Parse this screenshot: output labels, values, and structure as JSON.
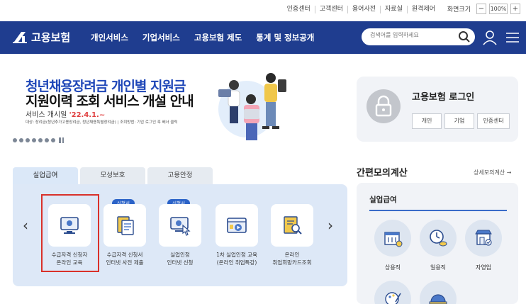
{
  "util": {
    "links": [
      "인증센터",
      "고객센터",
      "용어사전",
      "자료실",
      "원격제어"
    ],
    "zoom_label": "화면크기",
    "zoom_minus": "−",
    "zoom_value": "100%",
    "zoom_plus": "+"
  },
  "header": {
    "logo_text": "고용보험",
    "nav": [
      "개인서비스",
      "기업서비스",
      "고용보험 제도",
      "통계 및 정보공개"
    ],
    "search_placeholder": "검색어를 입력하세요",
    "icons": [
      "search-icon",
      "user-icon",
      "menu-icon"
    ],
    "brand_color": "#1f3d8f"
  },
  "banner": {
    "line1": "청년채용장려금 개인별 지원금",
    "line2": "지원이력 조회 서비스 개설 안내",
    "open_label": "서비스 개시일 ",
    "open_date": "'22.4.1.~",
    "note": "대상: 장려금(청년추가고용장려금, 청년채용특별장려금) | 조회방법: 기업 로그인 후 배너 클릭",
    "slide_count": 7
  },
  "login": {
    "title": "고용보험 로그인",
    "buttons": [
      "개인",
      "기업",
      "인증센터"
    ]
  },
  "tabs": [
    "실업급여",
    "모성보호",
    "고용안정"
  ],
  "services": [
    {
      "label": "수급자격 신청자\n온라인 교육",
      "badge": "",
      "icon": "monitor-icon"
    },
    {
      "label": "수급자격 신청서\n인터넷 사전 제출",
      "badge": "신청서",
      "icon": "document-icon"
    },
    {
      "label": "실업인정\n인터넷 신청",
      "badge": "신청서",
      "icon": "computer-click-icon"
    },
    {
      "label": "1차 실업인정 교육\n(온라인 취업특강)",
      "badge": "",
      "icon": "video-lecture-icon"
    },
    {
      "label": "온라인\n취업희망카드조회",
      "badge": "",
      "icon": "card-search-icon"
    }
  ],
  "calc": {
    "title": "간편모의계산",
    "more": "상세모의계산 →",
    "subtitle": "실업급여",
    "items": [
      {
        "label": "상용직",
        "icon": "building-icon"
      },
      {
        "label": "일용직",
        "icon": "clock-coin-icon"
      },
      {
        "label": "자영업",
        "icon": "shop-icon"
      }
    ]
  }
}
